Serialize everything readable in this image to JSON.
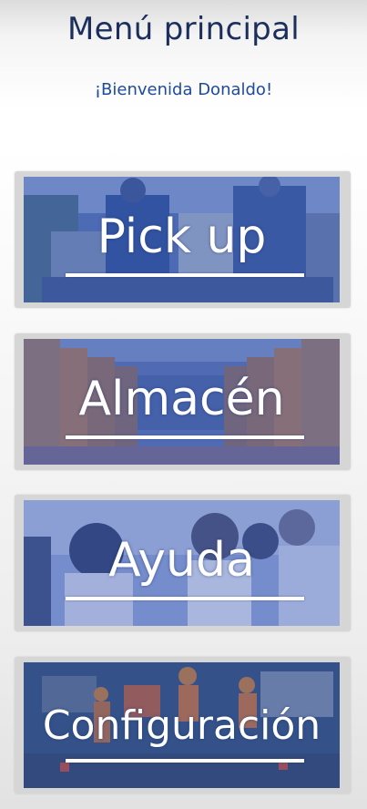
{
  "header": {
    "title": "Menú principal",
    "welcome": "¡Bienvenida Donaldo!"
  },
  "menu": {
    "items": [
      {
        "label": "Pick up",
        "photo": "warehouse-workers-photo"
      },
      {
        "label": "Almacén",
        "photo": "warehouse-shelves-photo"
      },
      {
        "label": "Ayuda",
        "photo": "call-center-photo"
      },
      {
        "label": "Configuración",
        "photo": "circuit-board-workers-photo"
      }
    ]
  },
  "colors": {
    "title": "#1c2f5c",
    "welcome": "#1e4a9a",
    "card_frame": "#d6d6d6",
    "overlay_blue": "#3a5bb0",
    "label": "#ffffff"
  }
}
